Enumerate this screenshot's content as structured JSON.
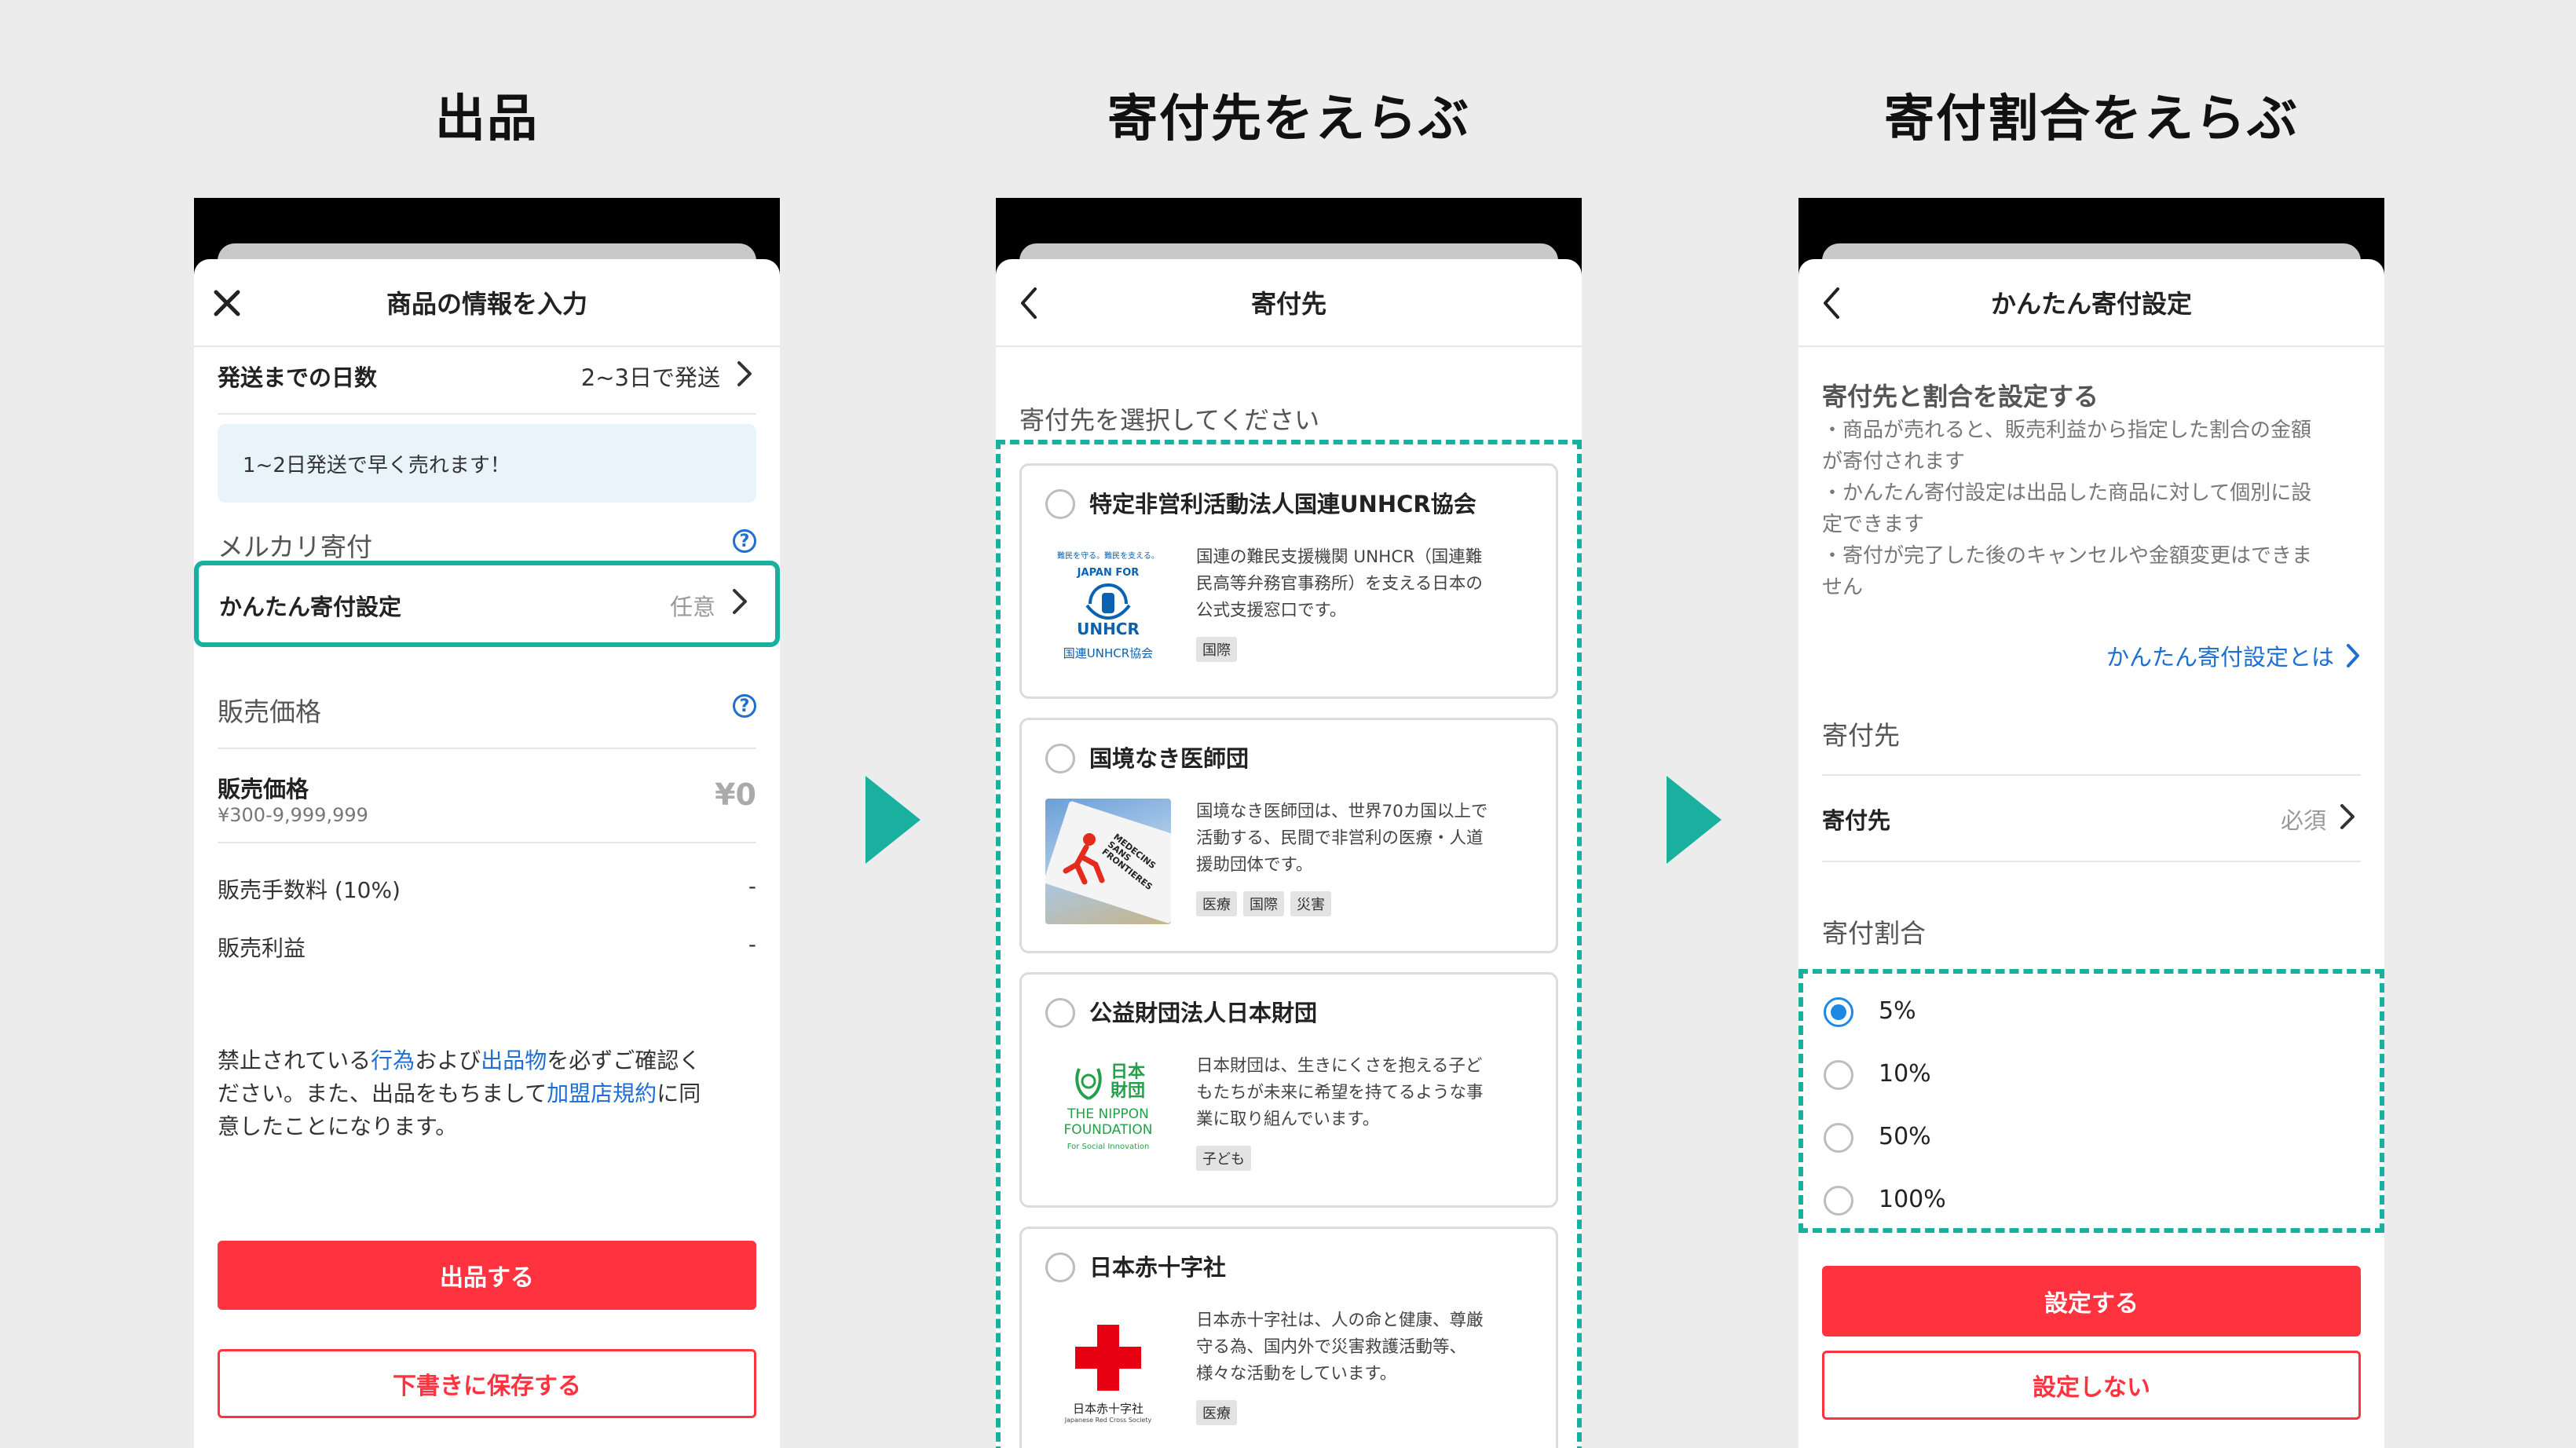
{
  "steps": [
    {
      "title": "出品"
    },
    {
      "title": "寄付先をえらぶ"
    },
    {
      "title": "寄付割合をえらぶ"
    }
  ],
  "screen1": {
    "nav_title": "商品の情報を入力",
    "shipping_label": "発送までの日数",
    "shipping_value": "2~3日で発送",
    "info_text": "1~2日発送で早く売れます！",
    "section_donation": "メルカリ寄付",
    "easy_donation_label": "かんたん寄付設定",
    "easy_donation_value": "任意",
    "section_price": "販売価格",
    "price_label": "販売価格",
    "price_range": "¥300-9,999,999",
    "price_value": "¥0",
    "fee_label": "販売手数料 (10%)",
    "fee_value": "-",
    "profit_label": "販売利益",
    "profit_value": "-",
    "notice_1": "禁止されている",
    "notice_link_1": "行為",
    "notice_2": "および",
    "notice_link_2": "出品物",
    "notice_3": "を必ずご確認く",
    "notice_4": "ださい。また、出品をもちまして",
    "notice_link_3": "加盟店規約",
    "notice_5": "に同",
    "notice_6": "意したことになります。",
    "submit_label": "出品する",
    "draft_label": "下書きに保存する"
  },
  "screen2": {
    "nav_title": "寄付先",
    "prompt": "寄付先を選択してください",
    "orgs": [
      {
        "name": "特定非営利活動法人国連UNHCR協会",
        "desc_lines": [
          "国連の難民支援機関 UNHCR（国連難",
          "民高等弁務官事務所）を支える日本の",
          "公式支援窓口です。"
        ],
        "tags": [
          "国際"
        ],
        "logo": {
          "tagline": "難民を守る。難民を支える。",
          "line1": "JAPAN FOR",
          "line2": "UNHCR",
          "line3": "国連UNHCR協会"
        }
      },
      {
        "name": "国境なき医師団",
        "desc_lines": [
          "国境なき医師団は、世界70カ国以上で",
          "活動する、民間で非営利の医療・人道",
          "援助団体です。"
        ],
        "tags": [
          "医療",
          "国際",
          "災害"
        ],
        "logo": {
          "flag_text": "MEDECINS SANS FRONTIERES"
        }
      },
      {
        "name": "公益財団法人日本財団",
        "desc_lines": [
          "日本財団は、生きにくさを抱える子ど",
          "もたちが未来に希望を持てるような事",
          "業に取り組んでいます。"
        ],
        "tags": [
          "子ども"
        ],
        "logo": {
          "line1": "日本",
          "line2": "財団",
          "line3": "THE NIPPON",
          "line4": "FOUNDATION",
          "line5": "For Social Innovation"
        }
      },
      {
        "name": "日本赤十字社",
        "desc_lines": [
          "日本赤十字社は、人の命と健康、尊厳",
          "守る為、国内外で災害救護活動等、",
          "様々な活動をしています。"
        ],
        "tags": [
          "医療"
        ],
        "logo": {
          "line1": "日本赤十字社",
          "line2": "Japanese Red Cross Society"
        }
      }
    ]
  },
  "screen3": {
    "nav_title": "かんたん寄付設定",
    "heading": "寄付先と割合を設定する",
    "bullets": [
      "・商品が売れると、販売利益から指定した割合の金額",
      "が寄付されます",
      "・かんたん寄付設定は出品した商品に対して個別に設",
      "定できます",
      "・寄付が完了した後のキャンセルや金額変更はできま",
      "せん"
    ],
    "about_link": "かんたん寄付設定とは",
    "section_target": "寄付先",
    "target_label": "寄付先",
    "target_value": "必須",
    "section_ratio": "寄付割合",
    "options": [
      {
        "label": "5%",
        "selected": true
      },
      {
        "label": "10%",
        "selected": false
      },
      {
        "label": "50%",
        "selected": false
      },
      {
        "label": "100%",
        "selected": false
      }
    ],
    "set_label": "設定する",
    "unset_label": "設定しない"
  },
  "colors": {
    "accent_teal": "#1ab0a0",
    "primary_red": "#ff333f",
    "link_blue": "#1e6fd1",
    "radio_blue": "#1e88e5"
  }
}
